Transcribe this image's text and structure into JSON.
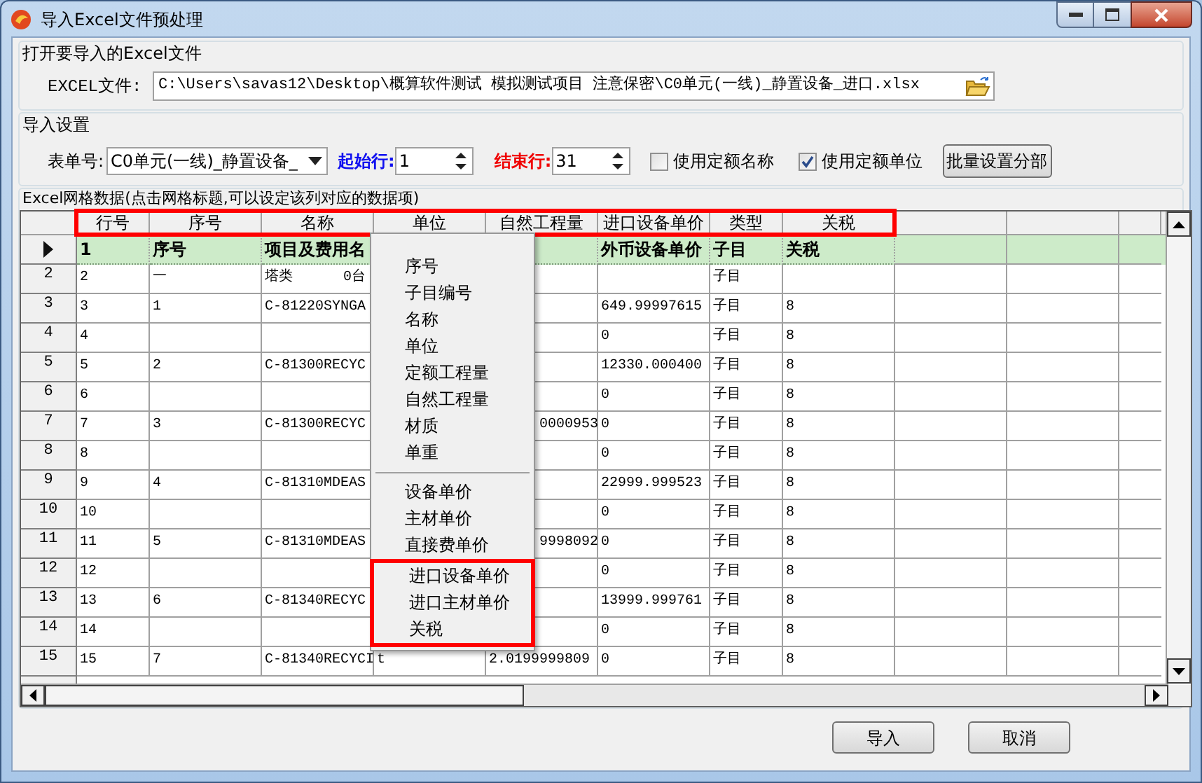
{
  "window": {
    "title": "导入Excel文件预处理"
  },
  "file_group": {
    "title": "打开要导入的Excel文件",
    "label": "EXCEL文件:",
    "path": "C:\\Users\\savas12\\Desktop\\概算软件测试 模拟测试项目 注意保密\\C0单元(一线)_静置设备_进口.xlsx"
  },
  "settings_group": {
    "title": "导入设置",
    "sheet_label": "表单号:",
    "sheet_value": "C0单元(一线)_静置设备_",
    "start_label": "起始行:",
    "start_value": "1",
    "end_label": "结束行:",
    "end_value": "31",
    "checkboxes": [
      {
        "label": "使用定额名称",
        "checked": false
      },
      {
        "label": "使用定额单位",
        "checked": true
      }
    ],
    "batch_button": "批量设置分部"
  },
  "grid_group": {
    "title": "Excel网格数据(点击网格标题,可以设定该列对应的数据项)"
  },
  "table": {
    "header_outlined": true,
    "columns": [
      "行号",
      "序号",
      "名称",
      "单位",
      "自然工程量",
      "进口设备单价",
      "类型",
      "关税"
    ],
    "rows": [
      {
        "kind": "title",
        "current": true,
        "cells": [
          "1",
          "序号",
          "项目及费用名",
          null,
          null,
          "外币设备单价",
          "子目",
          "关税"
        ]
      },
      {
        "kind": "data",
        "current": false,
        "header": "2",
        "cells": [
          "2",
          "一",
          "塔类      0台",
          null,
          null,
          null,
          "子目",
          null
        ]
      },
      {
        "kind": "data",
        "current": false,
        "header": "3",
        "cells": [
          "3",
          "1",
          "C-81220SYNGA",
          null,
          null,
          "649.99997615",
          "子目",
          "8"
        ]
      },
      {
        "kind": "data",
        "current": false,
        "header": "4",
        "cells": [
          "4",
          null,
          null,
          null,
          null,
          "0",
          "子目",
          "8"
        ]
      },
      {
        "kind": "data",
        "current": false,
        "header": "5",
        "cells": [
          "5",
          "2",
          "C-81300RECYC",
          null,
          null,
          "12330.000400",
          "子目",
          "8"
        ]
      },
      {
        "kind": "data",
        "current": false,
        "header": "6",
        "cells": [
          "6",
          null,
          null,
          null,
          null,
          "0",
          "子目",
          "8"
        ]
      },
      {
        "kind": "data",
        "current": false,
        "header": "7",
        "cells": [
          "7",
          "3",
          "C-81300RECYC",
          null,
          "0000953",
          "0",
          "子目",
          "8"
        ]
      },
      {
        "kind": "data",
        "current": false,
        "header": "8",
        "cells": [
          "8",
          null,
          null,
          null,
          null,
          "0",
          "子目",
          "8"
        ]
      },
      {
        "kind": "data",
        "current": false,
        "header": "9",
        "cells": [
          "9",
          "4",
          "C-81310MDEAS",
          null,
          null,
          "22999.999523",
          "子目",
          "8"
        ]
      },
      {
        "kind": "data",
        "current": false,
        "header": "10",
        "cells": [
          "10",
          null,
          null,
          null,
          null,
          "0",
          "子目",
          "8"
        ]
      },
      {
        "kind": "data",
        "current": false,
        "header": "11",
        "cells": [
          "11",
          "5",
          "C-81310MDEAS",
          null,
          "9998092",
          "0",
          "子目",
          "8"
        ]
      },
      {
        "kind": "data",
        "current": false,
        "header": "12",
        "cells": [
          "12",
          null,
          null,
          null,
          null,
          "0",
          "子目",
          "8"
        ]
      },
      {
        "kind": "data",
        "current": false,
        "header": "13",
        "cells": [
          "13",
          "6",
          "C-81340RECYC",
          null,
          null,
          "13999.999761",
          "子目",
          "8"
        ]
      },
      {
        "kind": "data",
        "current": false,
        "header": "14",
        "cells": [
          "14",
          null,
          null,
          null,
          null,
          "0",
          "子目",
          "8"
        ]
      },
      {
        "kind": "data",
        "current": false,
        "header": "15",
        "cells": [
          "15",
          "7",
          "C-81340RECYCI",
          "t",
          "2.0199999809",
          "0",
          "子目",
          "8"
        ]
      }
    ]
  },
  "context_menu": {
    "groups": [
      {
        "separator_before": false,
        "outlined": false,
        "items": [
          "序号",
          "子目编号",
          "名称",
          "单位",
          "定额工程量",
          "自然工程量",
          "材质",
          "单重"
        ]
      },
      {
        "separator_before": true,
        "outlined": false,
        "items": [
          "设备单价",
          "主材单价",
          "直接费单价"
        ]
      },
      {
        "separator_before": false,
        "outlined": true,
        "items": [
          "进口设备单价",
          "进口主材单价",
          "关税"
        ]
      }
    ]
  },
  "buttons": [
    "导入",
    "取消"
  ]
}
